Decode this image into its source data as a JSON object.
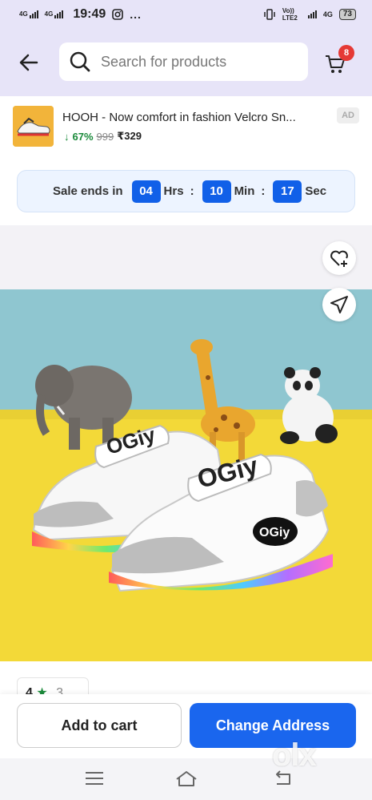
{
  "status_bar": {
    "network_left": "4G",
    "network_right": "4G",
    "time": "19:49",
    "indicators": "...",
    "carrier": "Vo)) LTE2",
    "carrier_net": "4G",
    "battery": "73"
  },
  "header": {
    "search_placeholder": "Search for products",
    "cart_count": "8"
  },
  "ad": {
    "title": "HOOH - Now comfort in fashion Velcro Sn...",
    "discount": "67%",
    "mrp": "999",
    "price": "₹329",
    "tag": "AD"
  },
  "sale": {
    "label": "Sale ends in",
    "hours": "04",
    "hours_unit": "Hrs",
    "minutes": "10",
    "minutes_unit": "Min",
    "seconds": "17",
    "seconds_unit": "Sec",
    "separator": ":"
  },
  "product_photo": {
    "brand_text": "OGiy"
  },
  "rating": {
    "value": "4",
    "count": "3"
  },
  "actions": {
    "add_to_cart": "Add to cart",
    "change_address": "Change Address"
  },
  "watermark": "olx",
  "colors": {
    "header_bg": "#e7e4f8",
    "primary": "#1a66ee",
    "discount": "#1a8a3a",
    "badge": "#e53935"
  }
}
